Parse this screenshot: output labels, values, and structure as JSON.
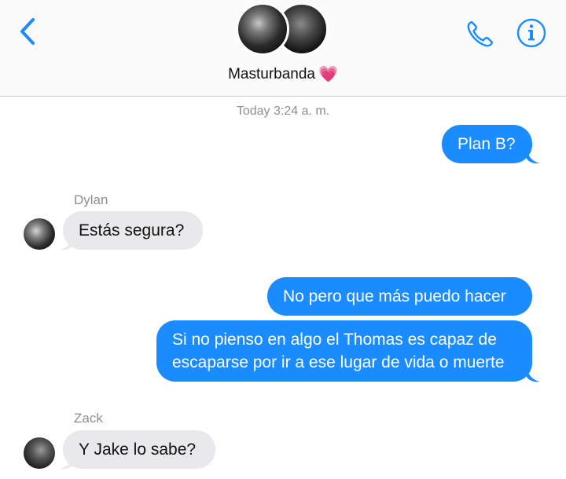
{
  "header": {
    "back_icon": "chevron-left-icon",
    "call_icon": "phone-icon",
    "info_icon": "info-icon",
    "group_name": "Masturbanda",
    "group_emoji": "💗",
    "accent_color": "#1a8cff"
  },
  "conversation": {
    "timestamp": "Today 3:24 a. m.",
    "messages": [
      {
        "direction": "outgoing",
        "text": "Plan B?"
      },
      {
        "direction": "incoming",
        "sender": "Dylan",
        "text": "Estás segura?"
      },
      {
        "direction": "outgoing",
        "text": "No pero que más puedo hacer"
      },
      {
        "direction": "outgoing",
        "lines": [
          "Si no pienso en algo el Thomas es capaz de",
          "escaparse por ir a ese lugar de vida o muerte"
        ]
      },
      {
        "direction": "incoming",
        "sender": "Zack",
        "text": "Y Jake lo sabe?"
      }
    ]
  }
}
